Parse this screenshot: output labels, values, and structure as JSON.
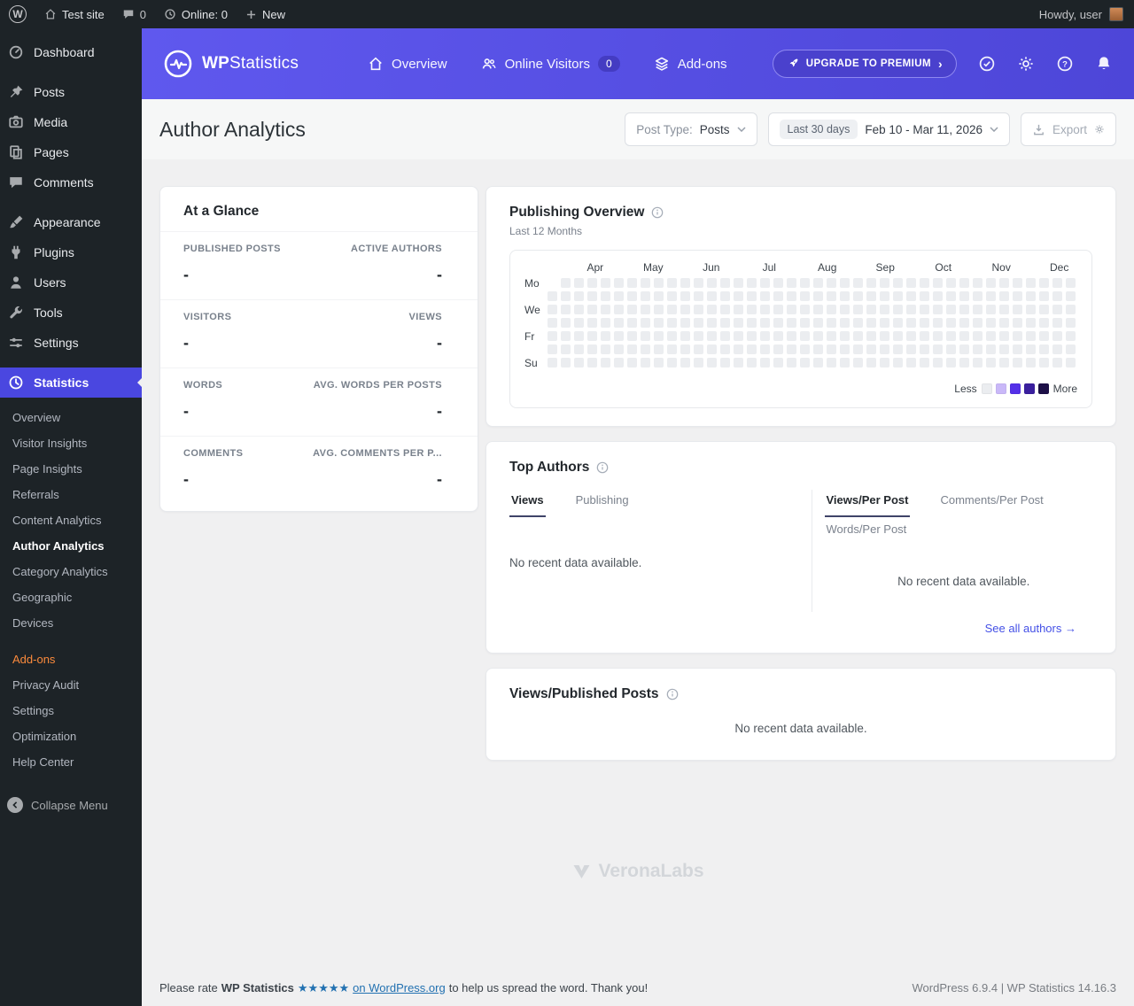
{
  "admin_bar": {
    "site_name": "Test site",
    "comments_count": "0",
    "online_label": "Online: 0",
    "new_label": "New",
    "howdy_label": "Howdy, user"
  },
  "sidebar": {
    "items": [
      {
        "label": "Dashboard",
        "icon": "dashboard-icon"
      },
      {
        "label": "Posts",
        "icon": "pin-icon",
        "group_start": true
      },
      {
        "label": "Media",
        "icon": "media-icon"
      },
      {
        "label": "Pages",
        "icon": "pages-icon"
      },
      {
        "label": "Comments",
        "icon": "comments-icon"
      },
      {
        "label": "Appearance",
        "icon": "appearance-icon",
        "group_start": true
      },
      {
        "label": "Plugins",
        "icon": "plugin-icon"
      },
      {
        "label": "Users",
        "icon": "users-icon"
      },
      {
        "label": "Tools",
        "icon": "tools-icon"
      },
      {
        "label": "Settings",
        "icon": "settings-icon"
      },
      {
        "label": "Statistics",
        "icon": "statistics-icon",
        "active": true,
        "group_start": true
      }
    ],
    "statistics_submenu": [
      {
        "label": "Overview"
      },
      {
        "label": "Visitor Insights"
      },
      {
        "label": "Page Insights"
      },
      {
        "label": "Referrals"
      },
      {
        "label": "Content Analytics"
      },
      {
        "label": "Author Analytics",
        "active": true
      },
      {
        "label": "Category Analytics"
      },
      {
        "label": "Geographic"
      },
      {
        "label": "Devices"
      },
      {
        "label": "Add-ons",
        "accent": true,
        "gap": true
      },
      {
        "label": "Privacy Audit"
      },
      {
        "label": "Settings"
      },
      {
        "label": "Optimization"
      },
      {
        "label": "Help Center"
      }
    ],
    "collapse_label": "Collapse Menu"
  },
  "header": {
    "brand_bold": "WP",
    "brand_rest": "Statistics",
    "nav": [
      {
        "label": "Overview",
        "icon": "home-icon"
      },
      {
        "label": "Online Visitors",
        "icon": "online-visitors-icon",
        "badge": "0"
      },
      {
        "label": "Add-ons",
        "icon": "addons-icon"
      }
    ],
    "upgrade_label": "UPGRADE TO PREMIUM"
  },
  "toolbar": {
    "page_title": "Author Analytics",
    "post_type_label": "Post Type:",
    "post_type_value": "Posts",
    "date_range_badge": "Last 30 days",
    "date_range_value": "Feb 10 - Mar 11, 2026",
    "export_label": "Export"
  },
  "glance": {
    "title": "At a Glance",
    "stats": [
      {
        "label": "PUBLISHED POSTS",
        "value": "-"
      },
      {
        "label": "ACTIVE AUTHORS",
        "value": "-"
      },
      {
        "label": "VISITORS",
        "value": "-"
      },
      {
        "label": "VIEWS",
        "value": "-"
      },
      {
        "label": "WORDS",
        "value": "-"
      },
      {
        "label": "AVG. WORDS PER POSTS",
        "value": "-"
      },
      {
        "label": "COMMENTS",
        "value": "-"
      },
      {
        "label": "AVG. COMMENTS PER P...",
        "value": "-"
      }
    ]
  },
  "publishing_overview": {
    "title": "Publishing Overview",
    "subtitle": "Last 12 Months",
    "months": [
      "Apr",
      "May",
      "Jun",
      "Jul",
      "Aug",
      "Sep",
      "Oct",
      "Nov",
      "Dec"
    ],
    "day_labels": [
      "Mo",
      "We",
      "Fr",
      "Su"
    ],
    "weeks": 40,
    "empty_cell_color": "#ebedf0",
    "legend": {
      "less_label": "Less",
      "more_label": "More",
      "colors": [
        "#ebedf0",
        "#c9b8f8",
        "#5430e8",
        "#3a1f9e",
        "#1d1047"
      ]
    }
  },
  "top_authors": {
    "title": "Top Authors",
    "left_tabs": [
      {
        "label": "Views",
        "active": true
      },
      {
        "label": "Publishing",
        "active": false
      }
    ],
    "right_tabs": [
      {
        "label": "Views/Per Post",
        "active": true
      },
      {
        "label": "Comments/Per Post",
        "active": false
      },
      {
        "label": "Words/Per Post",
        "active": false
      }
    ],
    "empty_text": "No recent data available.",
    "see_all_label": "See all authors"
  },
  "views_published": {
    "title": "Views/Published Posts",
    "empty_text": "No recent data available."
  },
  "watermark_label": "VeronaLabs",
  "footer": {
    "pre": "Please rate",
    "plugin_name": "WP Statistics",
    "stars": "★★★★★",
    "link_text": "on WordPress.org",
    "post": "to help us spread the word. Thank you!",
    "right_text": "WordPress 6.9.4 | WP Statistics 14.16.3"
  }
}
